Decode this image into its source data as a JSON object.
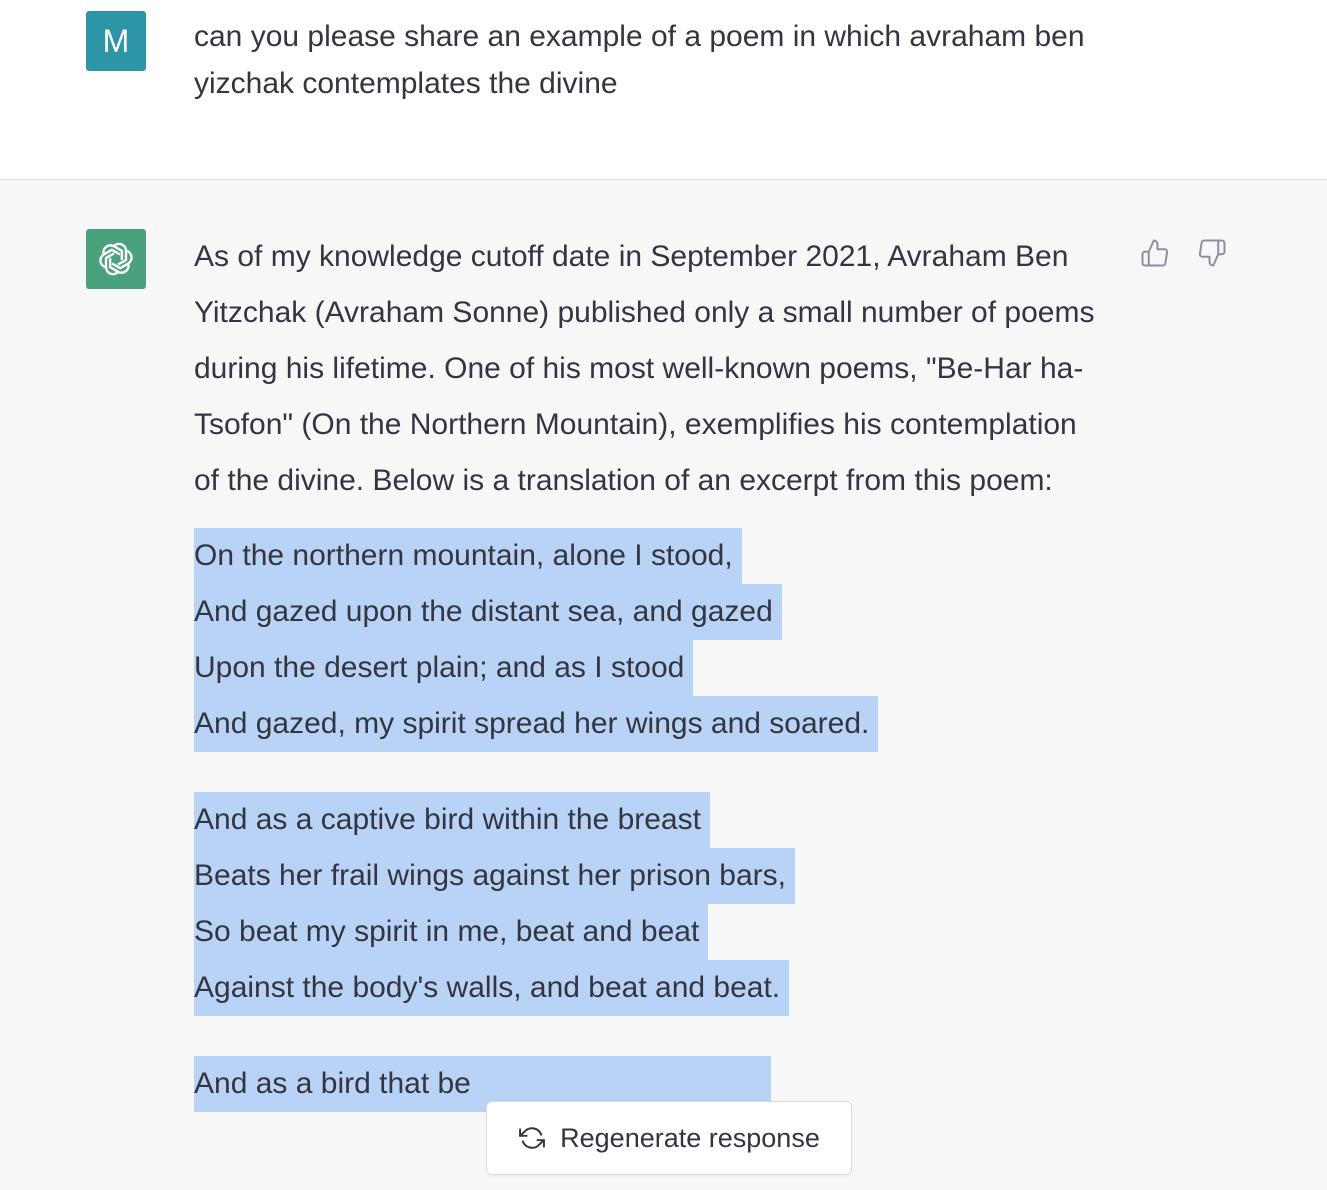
{
  "user_message": {
    "avatar_letter": "M",
    "text": "can you please share an example of a poem in which avraham ben yizchak contemplates the divine"
  },
  "assistant_message": {
    "avatar_icon": "openai-logo-icon",
    "intro": "As of my knowledge cutoff date in September 2021, Avraham Ben Yitzchak (Avraham Sonne) published only a small number of poems during his lifetime. One of his most well-known poems, \"Be-Har ha-Tsofon\" (On the Northern Mountain), exemplifies his contemplation of the divine. Below is a translation of an excerpt from this poem:",
    "stanzas": [
      {
        "lines": [
          "On the northern mountain, alone I stood,",
          "And gazed upon the distant sea, and gazed",
          "Upon the desert plain; and as I stood",
          "And gazed, my spirit spread her wings and soared."
        ]
      },
      {
        "lines": [
          "And as a captive bird within the breast",
          "Beats her frail wings against her prison bars,",
          "So beat my spirit in me, beat and beat",
          "Against the body's walls, and beat and beat."
        ]
      },
      {
        "lines": [
          "And as a bird that be"
        ]
      }
    ]
  },
  "controls": {
    "thumbs_up_icon": "thumbs-up-icon",
    "thumbs_down_icon": "thumbs-down-icon",
    "regenerate_label": "Regenerate response",
    "regenerate_icon": "refresh-icon"
  },
  "colors": {
    "user_avatar": "#2e95a6",
    "bot_avatar": "#4aa17e",
    "selection_highlight": "#b8d3f5",
    "assistant_background": "#f7f7f8",
    "text": "#343541"
  }
}
